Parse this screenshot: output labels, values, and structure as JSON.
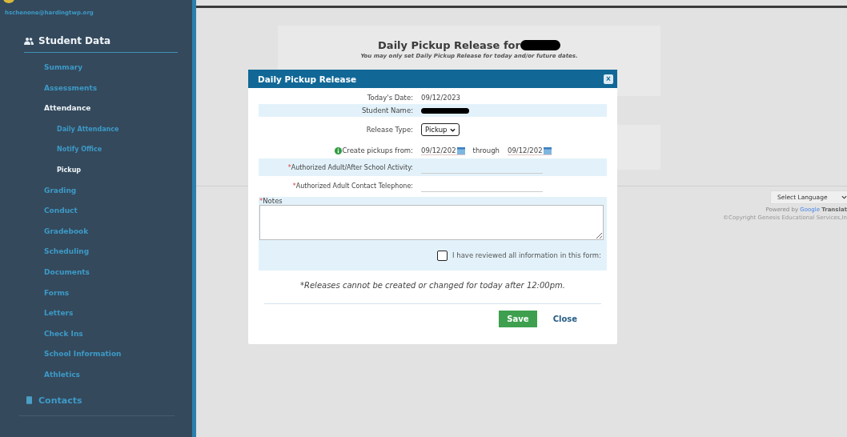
{
  "sidebar": {
    "email": "hschenone@hardingtwp.org",
    "section": {
      "label": "Student Data",
      "items": [
        {
          "label": "Summary",
          "selected": false
        },
        {
          "label": "Assessments",
          "selected": false
        },
        {
          "label": "Attendance",
          "selected": true,
          "children": [
            {
              "label": "Daily Attendance",
              "selected": false
            },
            {
              "label": "Notify Office",
              "selected": false
            },
            {
              "label": "Pickup",
              "selected": true
            }
          ]
        },
        {
          "label": "Grading",
          "selected": false
        },
        {
          "label": "Conduct",
          "selected": false
        },
        {
          "label": "Gradebook",
          "selected": false
        },
        {
          "label": "Scheduling",
          "selected": false
        },
        {
          "label": "Documents",
          "selected": false
        },
        {
          "label": "Forms",
          "selected": false
        },
        {
          "label": "Letters",
          "selected": false
        },
        {
          "label": "Check Ins",
          "selected": false
        },
        {
          "label": "School Information",
          "selected": false
        },
        {
          "label": "Athletics",
          "selected": false
        }
      ]
    },
    "contacts": "Contacts"
  },
  "page": {
    "title": "Daily Pickup Release for",
    "subtitle": "You may only set Daily Pickup Release for today and/or future dates."
  },
  "footer": {
    "language": "Select Language",
    "powered_by": "Powered by",
    "google": "Google",
    "translate": "Translat",
    "copyright": "©Copyright Genesis Educational Services,In"
  },
  "modal": {
    "title": "Daily Pickup Release",
    "close": "×",
    "rows": [
      {
        "kind": "text",
        "label": "Today's Date:",
        "value": "09/12/2023",
        "shaded": false
      },
      {
        "kind": "redacted",
        "label": "Student Name:",
        "shaded": true
      },
      {
        "kind": "select",
        "label": "Release Type:",
        "value": "Pickup",
        "shaded": false
      },
      {
        "kind": "daterange",
        "label": "Create pickups from:",
        "from": "09/12/202",
        "between": "through",
        "to": "09/12/202",
        "shaded": false
      },
      {
        "kind": "input",
        "label": "Authorized Adult/After School Activity:",
        "marker": "*",
        "shaded": true
      },
      {
        "kind": "input",
        "label": "Authorized Adult Contact Telephone:",
        "marker": "*",
        "shaded": false
      }
    ],
    "notes": {
      "marker": "*",
      "label": "Notes"
    },
    "confirm": {
      "label": "I have reviewed all information in this form:",
      "checked": false
    },
    "footnote": "*Releases cannot be created or changed for today after 12:00pm.",
    "buttons": [
      {
        "kind": "primary",
        "label": "Save"
      },
      {
        "kind": "link",
        "label": "Close"
      }
    ]
  }
}
